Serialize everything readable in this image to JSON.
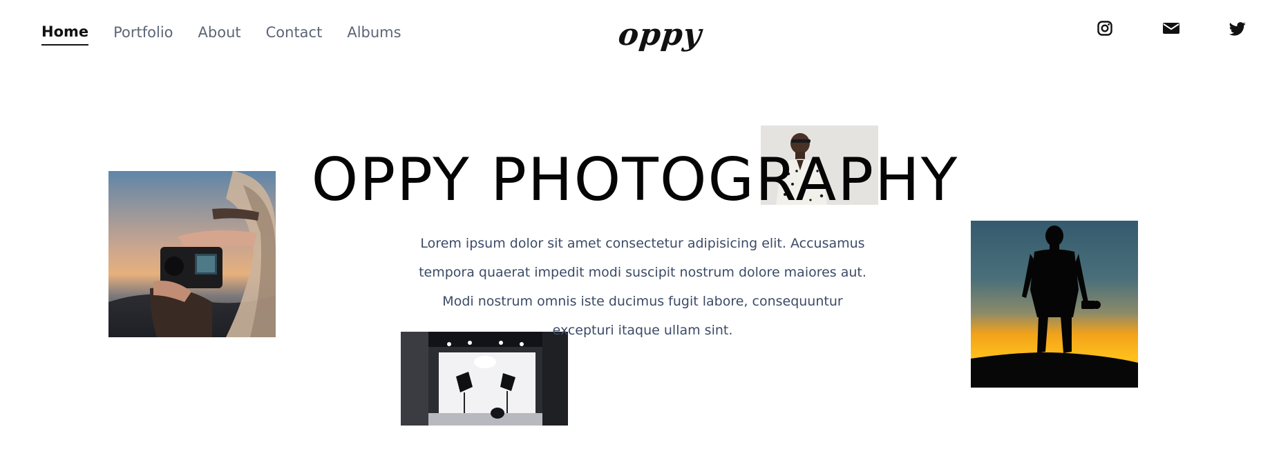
{
  "nav": {
    "items": [
      {
        "label": "Home",
        "active": true
      },
      {
        "label": "Portfolio",
        "active": false
      },
      {
        "label": "About",
        "active": false
      },
      {
        "label": "Contact",
        "active": false
      },
      {
        "label": "Albums",
        "active": false
      }
    ]
  },
  "brand": {
    "logo_text": "oppy"
  },
  "social": {
    "icons": [
      "instagram-icon",
      "mail-icon",
      "twitter-icon"
    ]
  },
  "hero": {
    "title": "OPPY PHOTOGRAPHY",
    "paragraph": "Lorem ipsum dolor sit amet consectetur adipisicing elit. Accusamus tempora quaerat impedit modi suscipit nostrum dolore maiores aut. Modi nostrum omnis iste ducimus fugit labore, consequuntur excepturi itaque ullam sint."
  },
  "colors": {
    "text_dark": "#111111",
    "nav_muted": "#5b6676",
    "paragraph": "#3b4a66"
  }
}
